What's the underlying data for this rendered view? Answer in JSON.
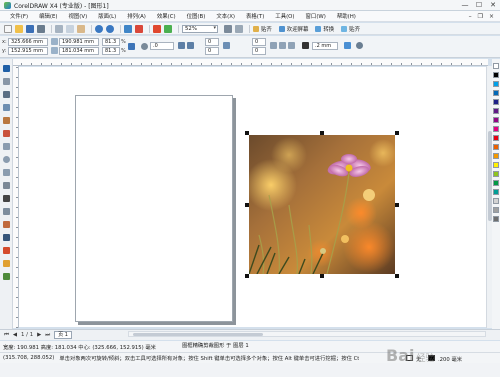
{
  "window": {
    "title": "CorelDRAW X4 (专业版) - [图形1]",
    "controls": [
      "—",
      "☐",
      "✕"
    ]
  },
  "menu": [
    "文件(F)",
    "编辑(E)",
    "视图(V)",
    "版面(L)",
    "排列(A)",
    "效果(C)",
    "位图(B)",
    "文本(X)",
    "表格(T)",
    "工具(O)",
    "窗口(W)",
    "帮助(H)"
  ],
  "toolbar": {
    "zoom_value": "52%",
    "snap_label": "贴齐",
    "welcome_label": "欢迎屏幕",
    "convert_label": "转换",
    "paste_label": "贴齐"
  },
  "property_bar": {
    "x_label": "x:",
    "x_value": "325.666 mm",
    "y_label": "y:",
    "y_value": "152.915 mm",
    "width_value": "190.981 mm",
    "height_value": "181.034 mm",
    "scale_x": "81.3",
    "scale_y": "81.3",
    "percent": "%",
    "rotation": ".0",
    "offset_1": "0",
    "offset_2": "0",
    "offset_3": "0",
    "offset_4": "0",
    "outline_width": ".2 mm"
  },
  "page_nav": {
    "position": "1 / 1",
    "page_tab": "页 1"
  },
  "status": {
    "dimensions": "宽度: 190.981 高度: 181.034 中心: (325.666, 152.915) 毫米",
    "selection": "图框精确剪裁图形 于 图层 1",
    "cursor": "(315.708, 288.052)",
    "hint": "单击对象两次可旋转/倾斜；双击工具可选择所有对象；按住 Shift 键单击可选择多个对象；按住 Alt 键单击可进行挖掘；按住 Ctrl 并单...",
    "fill": "无",
    "outline": ".200 毫米"
  },
  "watermark": {
    "text": "Bai",
    "suffix": "经验"
  },
  "colors": {
    "palette": [
      "#ffffff",
      "#000000",
      "#00a0e9",
      "#0068b7",
      "#1d2088",
      "#601986",
      "#920783",
      "#e4007f",
      "#e60012",
      "#eb6100",
      "#f39800",
      "#fff100",
      "#8fc31f",
      "#009944",
      "#009e96",
      "#d3d3d3",
      "#a0a0a0",
      "#6e6e6e"
    ]
  }
}
